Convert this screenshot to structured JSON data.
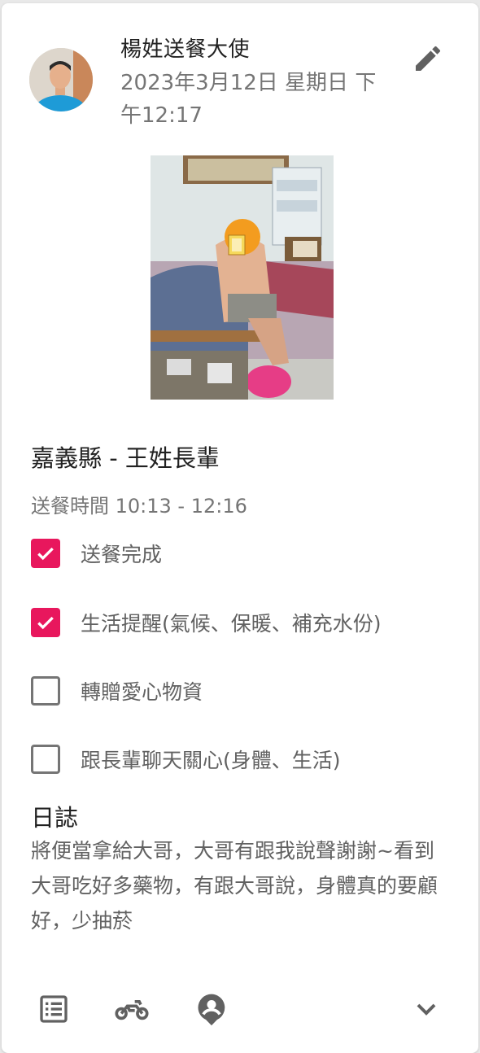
{
  "post": {
    "author": "楊姓送餐大使",
    "timestamp": "2023年3月12日 星期日 下午12:17",
    "edit_icon": "pencil-icon",
    "title": "嘉義縣 - 王姓長輩",
    "delivery_time": "送餐時間 10:13 - 12:16"
  },
  "checklist": [
    {
      "label": "送餐完成",
      "checked": true
    },
    {
      "label": "生活提醒(氣候、保暖、補充水份)",
      "checked": true
    },
    {
      "label": "轉贈愛心物資",
      "checked": false
    },
    {
      "label": "跟長輩聊天關心(身體、生活)",
      "checked": false
    }
  ],
  "log": {
    "title": "日誌",
    "text": "將便當拿給大哥，大哥有跟我說聲謝謝~看到大哥吃好多藥物，有跟大哥說，身體真的要顧好，少抽菸"
  },
  "toolbar": {
    "icons": [
      "list-icon",
      "motorcycle-icon",
      "person-pin-icon",
      "chevron-down-icon"
    ]
  },
  "colors": {
    "accent": "#e8175d",
    "icon_gray": "#616161",
    "muted_text": "#757575"
  }
}
